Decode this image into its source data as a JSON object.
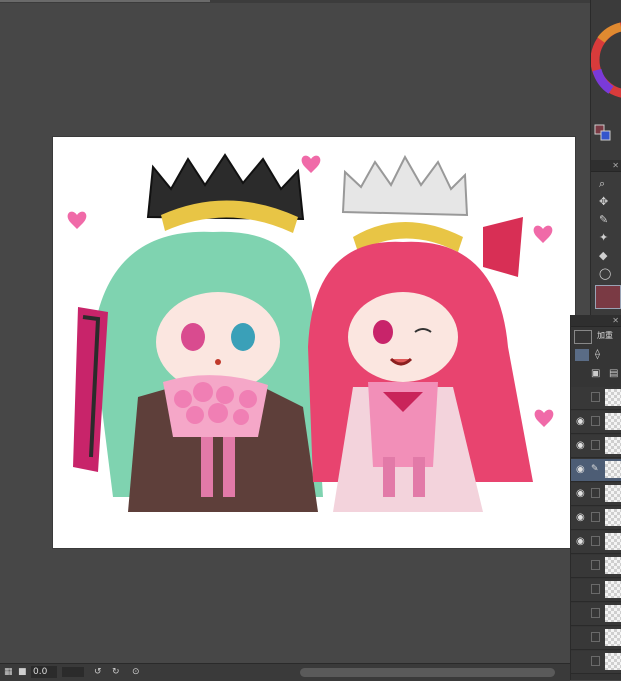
{
  "statusbar": {
    "zoom_value": "0.0",
    "scrollbar_position": 0.52
  },
  "layers": {
    "header_label": "加重"
  },
  "colors": {
    "background": "#474747",
    "panel": "#3b3b3b",
    "active_tool": "#5a6c86",
    "foreground_swatch": "#7a3a44"
  },
  "icons": {
    "eye": "eye-icon",
    "move": "move-tool-icon",
    "zoom": "zoom-tool-icon",
    "pen": "pen-tool-icon",
    "fill": "fill-tool-icon",
    "lasso": "lasso-tool-icon"
  }
}
